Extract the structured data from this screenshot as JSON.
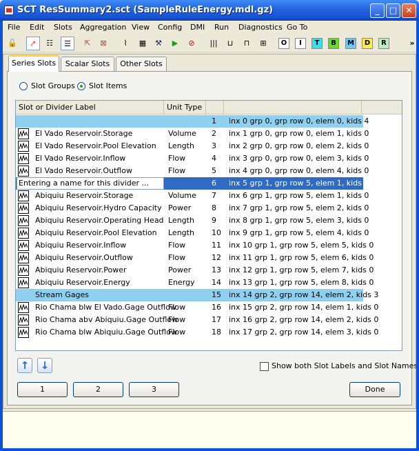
{
  "window": {
    "title": "SCT ResSummary2.sct (SampleRuleEnergy.mdl.gz)"
  },
  "menu": [
    "File",
    "Edit",
    "Slots",
    "Aggregation",
    "View",
    "Config",
    "DMI",
    "Run",
    "Diagnostics",
    "Go To"
  ],
  "toolbar": {
    "letters": [
      "O",
      "I",
      "T",
      "B",
      "M",
      "D",
      "R"
    ],
    "letter_colors": [
      "#FFFFFF",
      "#FFFFFF",
      "#33E0F0",
      "#66DD22",
      "#66CCFF",
      "#FFEE44",
      "#BBF0BB"
    ],
    "overflow": "»"
  },
  "tabs": [
    "Series Slots",
    "Scalar Slots",
    "Other Slots"
  ],
  "radios": {
    "groups": "Slot Groups",
    "items": "Slot Items",
    "selected": "items"
  },
  "table": {
    "headers": [
      "Slot or Divider Label",
      "Unit Type"
    ],
    "rows": [
      {
        "type": "divider",
        "selected": true,
        "label": "",
        "unit": "",
        "num": "1",
        "info": "inx 0 grp 0, grp row 0, elem 0, kids 4"
      },
      {
        "type": "slot",
        "label": "El Vado Reservoir.Storage",
        "unit": "Volume",
        "num": "2",
        "info": "inx 1 grp 0, grp row 0, elem 1, kids 0"
      },
      {
        "type": "slot",
        "label": "El Vado Reservoir.Pool Elevation",
        "unit": "Length",
        "num": "3",
        "info": "inx 2 grp 0, grp row 0, elem 2, kids 0"
      },
      {
        "type": "slot",
        "label": "El Vado Reservoir.Inflow",
        "unit": "Flow",
        "num": "4",
        "info": "inx 3 grp 0, grp row 0, elem 3, kids 0"
      },
      {
        "type": "slot",
        "label": "El Vado Reservoir.Outflow",
        "unit": "Flow",
        "num": "5",
        "info": "inx 4 grp 0, grp row 0, elem 4, kids 0"
      },
      {
        "type": "editing",
        "label": "Entering a name for this divider ...",
        "unit": "",
        "num": "6",
        "info": "inx 5 grp 1, grp row 5, elem 1, kids 8"
      },
      {
        "type": "slot",
        "label": "Abiquiu Reservoir.Storage",
        "unit": "Volume",
        "num": "7",
        "info": "inx 6 grp 1, grp row 5, elem 1, kids 0"
      },
      {
        "type": "slot",
        "label": "Abiquiu Reservoir.Hydro Capacity",
        "unit": "Power",
        "num": "8",
        "info": "inx 7 grp 1, grp row 5, elem 2, kids 0"
      },
      {
        "type": "slot",
        "label": "Abiquiu Reservoir.Operating Head",
        "unit": "Length",
        "num": "9",
        "info": "inx 8 grp 1, grp row 5, elem 3, kids 0"
      },
      {
        "type": "slot",
        "label": "Abiquiu Reservoir.Pool Elevation",
        "unit": "Length",
        "num": "10",
        "info": "inx 9 grp 1, grp row 5, elem 4, kids 0"
      },
      {
        "type": "slot",
        "label": "Abiquiu Reservoir.Inflow",
        "unit": "Flow",
        "num": "11",
        "info": "inx 10 grp 1, grp row 5, elem 5, kids 0"
      },
      {
        "type": "slot",
        "label": "Abiquiu Reservoir.Outflow",
        "unit": "Flow",
        "num": "12",
        "info": "inx 11 grp 1, grp row 5, elem 6, kids 0"
      },
      {
        "type": "slot",
        "label": "Abiquiu Reservoir.Power",
        "unit": "Power",
        "num": "13",
        "info": "inx 12 grp 1, grp row 5, elem 7, kids 0"
      },
      {
        "type": "slot",
        "label": "Abiquiu Reservoir.Energy",
        "unit": "Energy",
        "num": "14",
        "info": "inx 13 grp 1, grp row 5, elem 8, kids 0"
      },
      {
        "type": "divider",
        "selected": true,
        "label": "Stream Gages",
        "unit": "",
        "num": "15",
        "info": "inx 14 grp 2, grp row 14, elem 2, kids 3"
      },
      {
        "type": "slot",
        "label": "Rio Chama blw El Vado.Gage Outflow",
        "unit": "Flow",
        "num": "16",
        "info": "inx 15 grp 2, grp row 14, elem 1, kids 0"
      },
      {
        "type": "slot",
        "label": "Rio Chama abv Abiquiu.Gage Outflow",
        "unit": "Flow",
        "num": "17",
        "info": "inx 16 grp 2, grp row 14, elem 2, kids 0"
      },
      {
        "type": "slot",
        "label": "Rio Chama blw Abiquiu.Gage Outflow",
        "unit": "Flow",
        "num": "18",
        "info": "inx 17 grp 2, grp row 14, elem 3, kids 0"
      }
    ]
  },
  "checkbox": {
    "label": "Show both Slot Labels and Slot Names",
    "checked": false
  },
  "buttons": {
    "one": "1",
    "two": "2",
    "three": "3",
    "done": "Done"
  }
}
